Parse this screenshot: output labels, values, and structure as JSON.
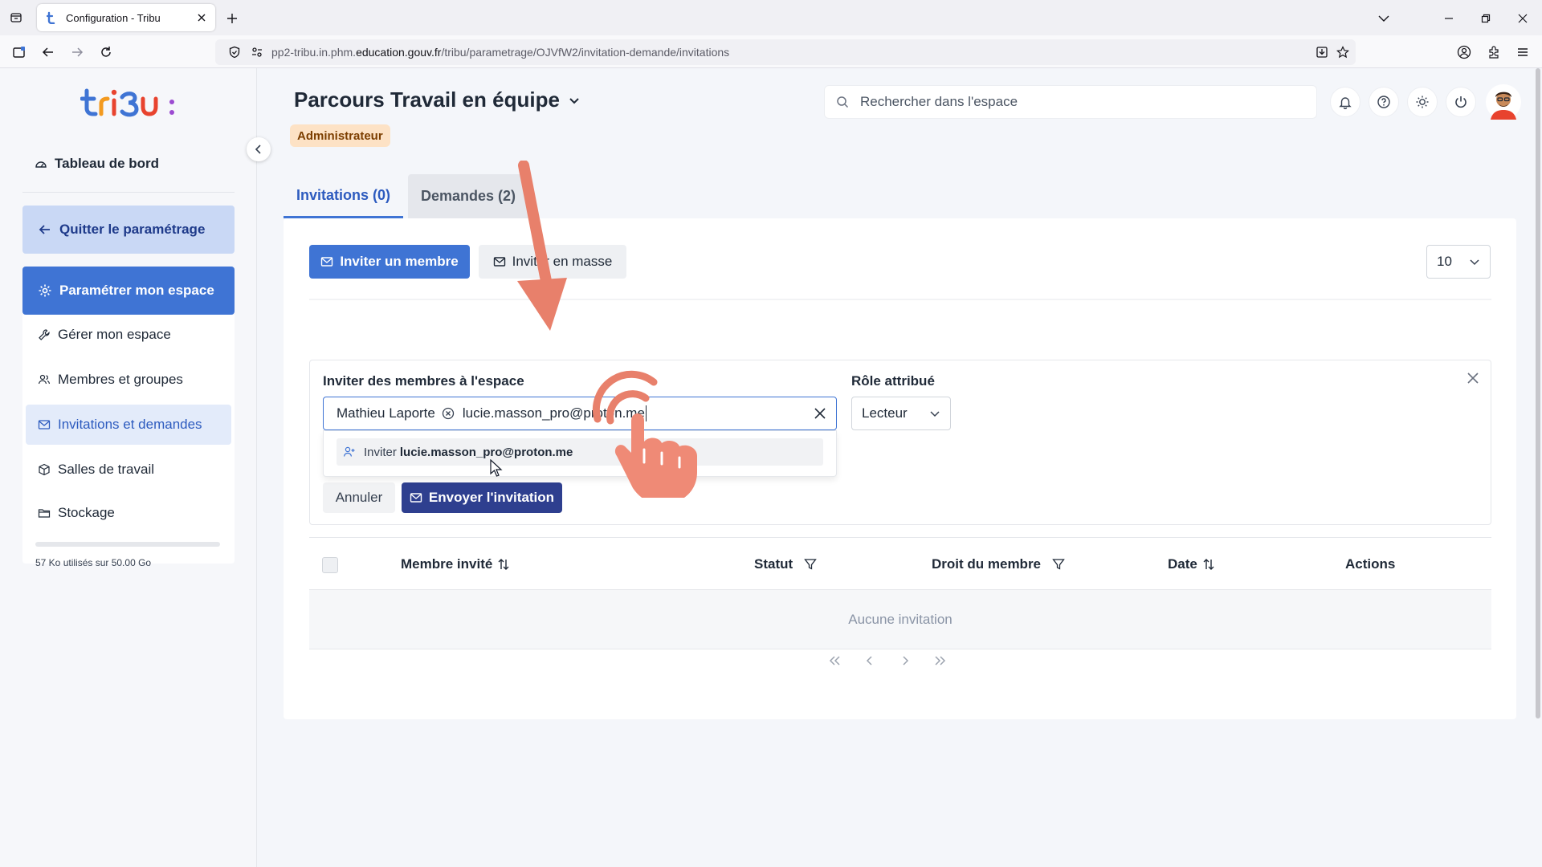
{
  "browser": {
    "tab_title": "Configuration - Tribu",
    "url_prefix": "pp2-tribu.in.phm.",
    "url_domain": "education.gouv.fr",
    "url_path": "/tribu/parametrage/OJVfW2/invitation-demande/invitations"
  },
  "sidebar": {
    "dashboard": "Tableau de bord",
    "quit": "Quitter le paramétrage",
    "configure": "Paramétrer mon espace",
    "items": [
      {
        "label": "Gérer mon espace",
        "icon": "wrench-icon"
      },
      {
        "label": "Membres et groupes",
        "icon": "users-icon"
      },
      {
        "label": "Invitations et demandes",
        "icon": "mail-icon"
      },
      {
        "label": "Salles de travail",
        "icon": "cube-icon"
      },
      {
        "label": "Stockage",
        "icon": "folder-icon"
      }
    ],
    "storage_used_fraction": 1e-06,
    "storage_text": "57 Ko utilisés sur 50.00 Go"
  },
  "header": {
    "space_title": "Parcours Travail en équipe",
    "role_badge": "Administrateur",
    "search_placeholder": "Rechercher dans l'espace"
  },
  "tabs": [
    {
      "label": "Invitations (0)",
      "active": true
    },
    {
      "label": "Demandes (2)",
      "active": false
    }
  ],
  "toolbar": {
    "invite_member": "Inviter un membre",
    "invite_bulk": "Inviter en masse",
    "per_page": "10"
  },
  "invite_form": {
    "members_label": "Inviter des membres à l'espace",
    "chip": "Mathieu Laporte",
    "typed_value": "lucie.masson_pro@proton.me",
    "suggestion_prefix": "Inviter",
    "suggestion_email": "lucie.masson_pro@proton.me",
    "role_label": "Rôle attribué",
    "role_value": "Lecteur",
    "cancel": "Annuler",
    "send": "Envoyer l'invitation"
  },
  "table": {
    "columns": [
      "Membre invité",
      "Statut",
      "Droit du membre",
      "Date",
      "Actions"
    ],
    "empty": "Aucune invitation"
  },
  "colors": {
    "primary": "#3f74d4",
    "send_button": "#2e3f8f",
    "badge_bg": "#fde2c5",
    "annotation": "#e8806b"
  }
}
